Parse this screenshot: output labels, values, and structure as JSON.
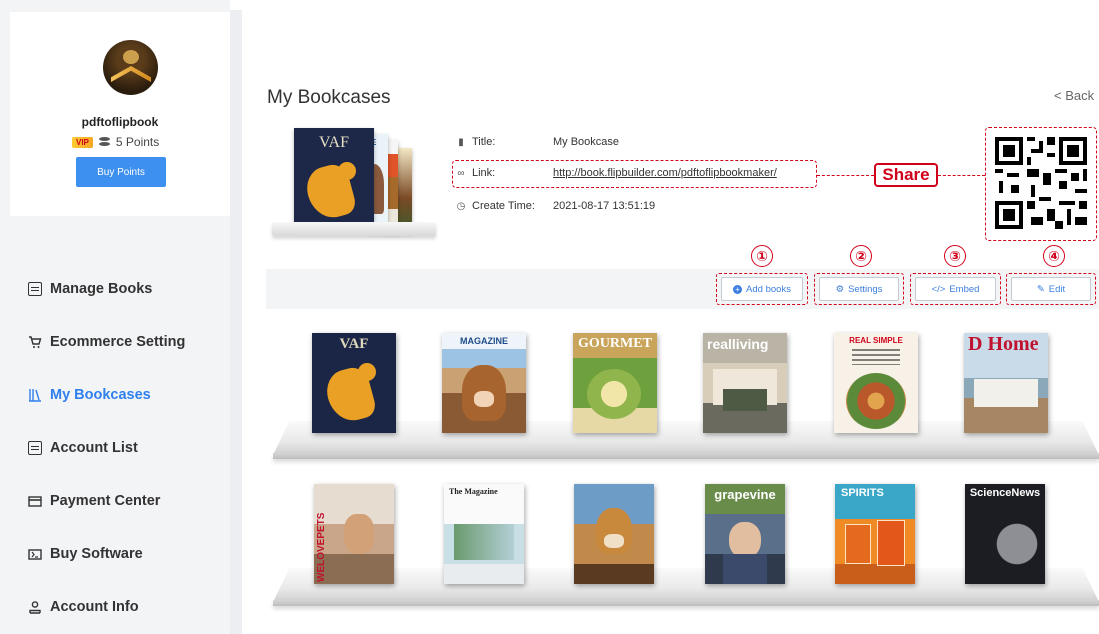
{
  "sidebar": {
    "username": "pdftoflipbook",
    "vip_label": "VIP",
    "points": "5 Points",
    "buy_points": "Buy Points",
    "items": [
      {
        "label": "Manage Books",
        "icon": "manage-books-icon"
      },
      {
        "label": "Ecommerce Setting",
        "icon": "cart-icon"
      },
      {
        "label": "My Bookcases",
        "icon": "bookcase-icon",
        "active": true
      },
      {
        "label": "Account List",
        "icon": "list-icon"
      },
      {
        "label": "Payment Center",
        "icon": "card-icon"
      },
      {
        "label": "Buy Software",
        "icon": "software-icon"
      },
      {
        "label": "Account Info",
        "icon": "user-icon"
      }
    ]
  },
  "main": {
    "title": "My Bookcases",
    "back": "< Back",
    "info": {
      "title_label": "Title:",
      "title_value": "My Bookcase",
      "link_label": "Link:",
      "link_value": "http://book.flipbuilder.com/pdftoflipbookmaker/",
      "time_label": "Create Time:",
      "time_value": "2021-08-17 13:51:19"
    },
    "share": "Share",
    "toolbar": {
      "add_books": "Add books",
      "settings": "Settings",
      "embed": "Embed",
      "edit": "Edit"
    },
    "steps": [
      "①",
      "②",
      "③",
      "④"
    ]
  },
  "books": {
    "row1": [
      "VAF",
      "MAGAZINE",
      "GOURMET",
      "realliving",
      "REAL SIMPLE",
      "D Home"
    ],
    "row2": [
      "WELOVEPETS",
      "The Magazine",
      "",
      "grapevine",
      "SPIRITS",
      "ScienceNews"
    ]
  },
  "colors": {
    "accent": "#2f80ed",
    "button": "#3d8ff0",
    "annotation": "#d0021b"
  }
}
